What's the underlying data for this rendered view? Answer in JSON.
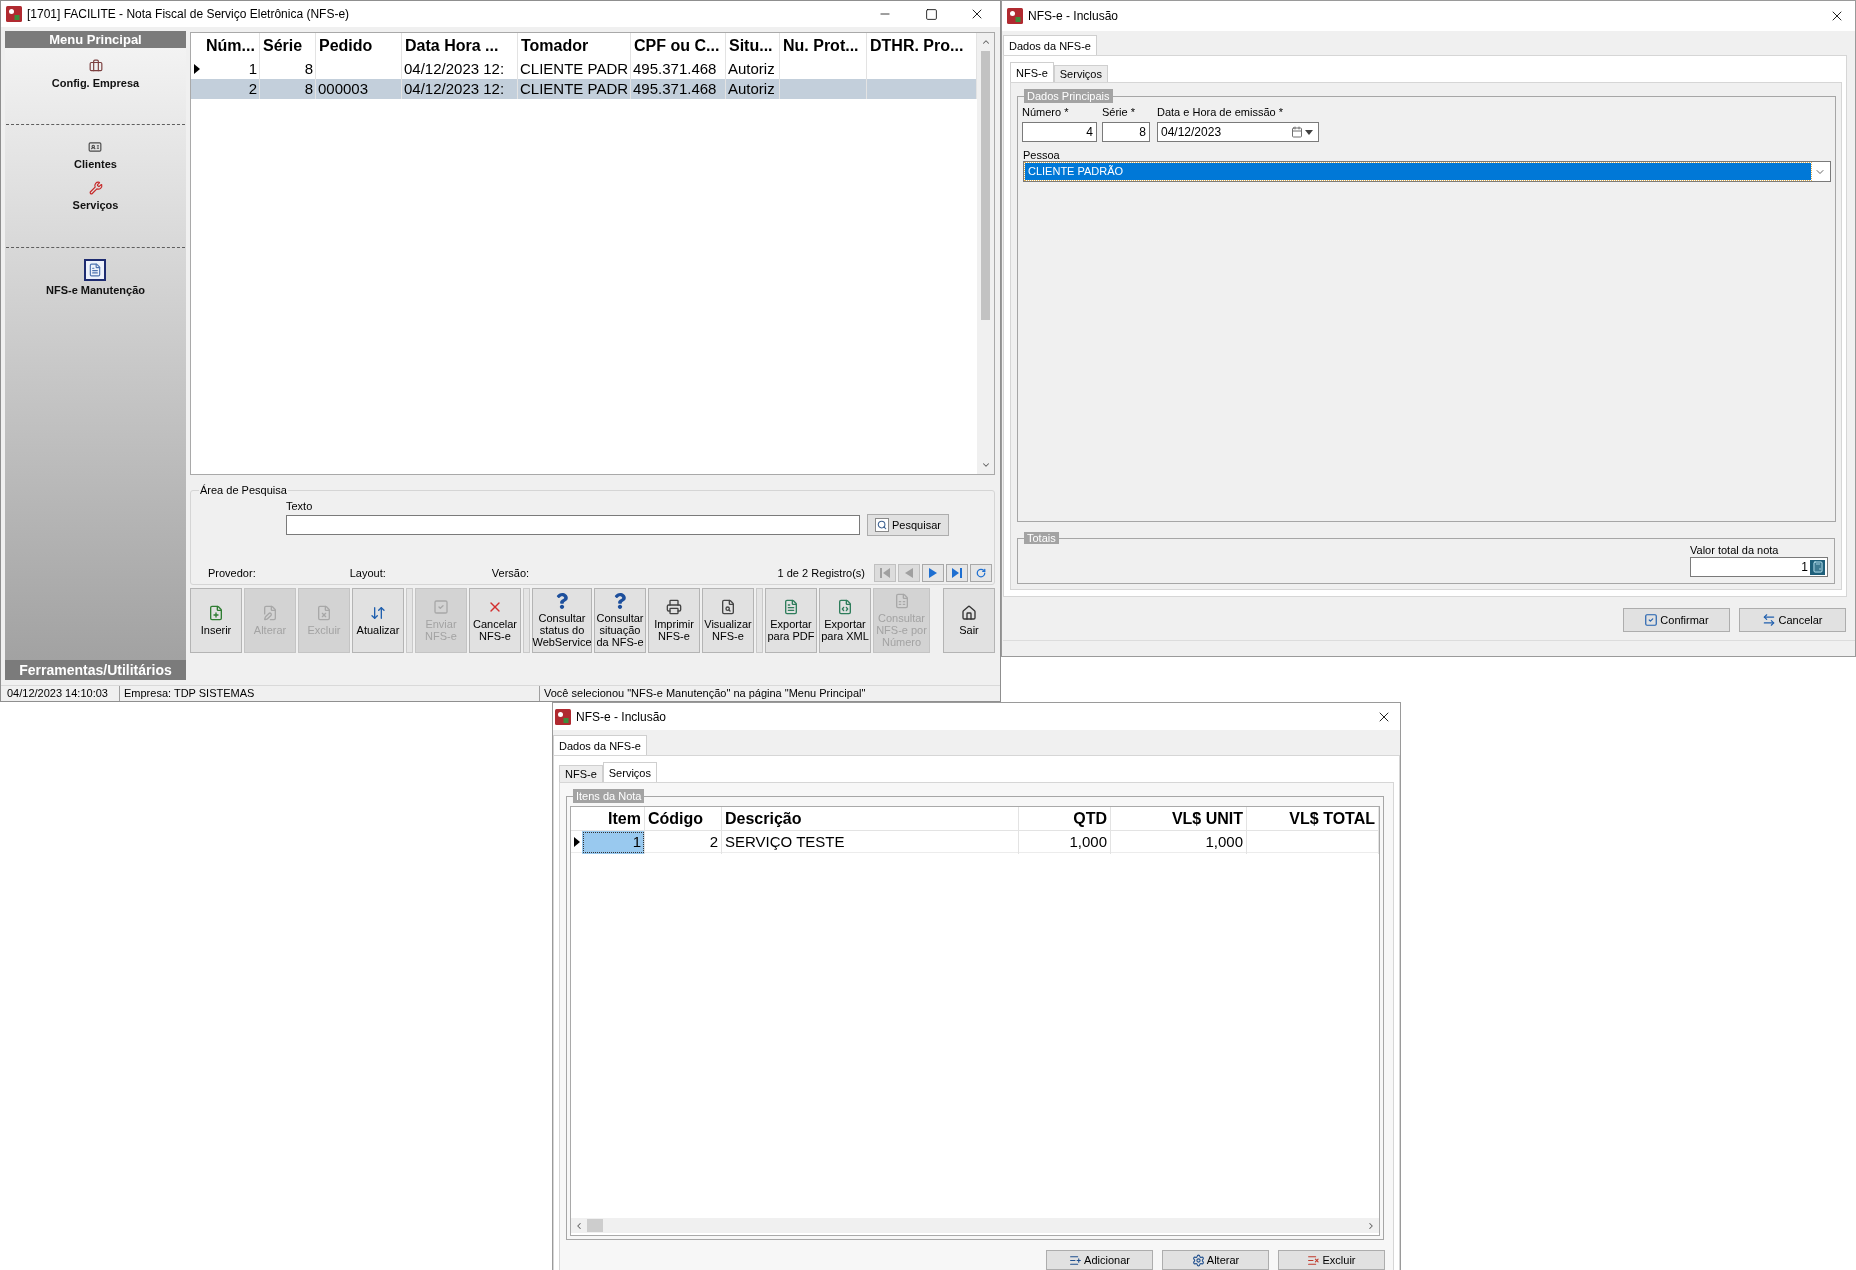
{
  "main_window": {
    "title": "[1701] FACILITE - Nota Fiscal de Serviço Eletrônica (NFS-e)",
    "sidebar": {
      "header": "Menu Principal",
      "groups": [
        {
          "items": [
            {
              "label": "Config. Empresa",
              "selected": false
            }
          ]
        },
        {
          "items": [
            {
              "label": "Clientes",
              "selected": false
            },
            {
              "label": "Serviços",
              "selected": false
            }
          ]
        },
        {
          "items": [
            {
              "label": "NFS-e Manutenção",
              "selected": true
            }
          ]
        }
      ],
      "footer": "Ferramentas/Utilitários"
    },
    "grid": {
      "columns": [
        {
          "label": "Núm..."
        },
        {
          "label": "Série"
        },
        {
          "label": "Pedido"
        },
        {
          "label": "Data Hora ..."
        },
        {
          "label": "Tomador"
        },
        {
          "label": "CPF ou C..."
        },
        {
          "label": "Situ..."
        },
        {
          "label": "Nu. Prot..."
        },
        {
          "label": "DTHR. Pro..."
        }
      ],
      "rows": [
        {
          "current": true,
          "selected": false,
          "cells": {
            "column_1": "1",
            "column_2": "8",
            "column_4": "04/12/2023 12:",
            "column_5": "CLIENTE PADR",
            "column_6": "495.371.468",
            "column_7": "Autoriz"
          }
        },
        {
          "current": false,
          "selected": true,
          "cells": {
            "column_1": "2",
            "column_2": "8",
            "column_3": "000003",
            "column_4": "04/12/2023 12:",
            "column_5": "CLIENTE PADR",
            "column_6": "495.371.468",
            "column_7": "Autoriz"
          }
        }
      ]
    },
    "search": {
      "title": "Área de Pesquisa",
      "field_label": "Texto",
      "button": "Pesquisar"
    },
    "info": {
      "provider_label": "Provedor:",
      "layout_label": "Layout:",
      "version_label": "Versão:",
      "record_count": "1 de 2 Registro(s)"
    },
    "navigation": [
      {
        "disabled": true
      },
      {
        "disabled": true
      },
      {
        "disabled": false
      },
      {
        "disabled": false
      },
      {
        "disabled": false
      }
    ],
    "toolbar": [
      {
        "kind": "button",
        "label": "Inserir",
        "disabled": false
      },
      {
        "kind": "button",
        "label": "Alterar",
        "disabled": true
      },
      {
        "kind": "button",
        "label": "Excluir",
        "disabled": true
      },
      {
        "kind": "button",
        "label": "Atualizar",
        "disabled": false
      },
      {
        "kind": "separator"
      },
      {
        "kind": "button",
        "label": "Enviar NFS-e",
        "disabled": true
      },
      {
        "kind": "button",
        "label": "Cancelar NFS-e",
        "disabled": false
      },
      {
        "kind": "separator"
      },
      {
        "kind": "button",
        "label": "Consultar status do WebService",
        "disabled": false
      },
      {
        "kind": "button",
        "label": "Consultar situação da NFS-e",
        "disabled": false
      },
      {
        "kind": "button",
        "label": "Imprimir NFS-e",
        "disabled": false
      },
      {
        "kind": "button",
        "label": "Visualizar NFS-e",
        "disabled": false
      },
      {
        "kind": "separator"
      },
      {
        "kind": "button",
        "label": "Exportar para PDF",
        "disabled": false
      },
      {
        "kind": "button",
        "label": "Exportar para XML",
        "disabled": false
      },
      {
        "kind": "button",
        "label": "Consultar NFS-e por Número",
        "disabled": true
      },
      {
        "kind": "button",
        "label": "Sair",
        "disabled": false
      }
    ],
    "status_bar": {
      "datetime": "04/12/2023 14:10:03",
      "company": "Empresa: TDP SISTEMAS",
      "message": "Você selecionou \"NFS-e Manutenção\" na página \"Menu Principal\""
    }
  },
  "inclusion_dialog": {
    "title": "NFS-e - Inclusão",
    "tabs": [
      {
        "label": "Dados da NFS-e",
        "selected": true
      }
    ],
    "inner_tabs": [
      {
        "label": "NFS-e",
        "selected": true
      },
      {
        "label": "Serviços",
        "selected": false
      }
    ],
    "main_group": {
      "title": "Dados Principais",
      "numero": {
        "label": "Número *",
        "value": "4"
      },
      "serie": {
        "label": "Série *",
        "value": "8"
      },
      "emissao": {
        "label": "Data e Hora de emissão *",
        "value": "04/12/2023"
      },
      "pessoa": {
        "label": "Pessoa",
        "value": "CLIENTE PADRÃO",
        "highlighted": true
      }
    },
    "totals": {
      "title": "Totais",
      "label": "Valor total da nota",
      "value": "1"
    },
    "buttons": [
      {
        "label": "Confirmar"
      },
      {
        "label": "Cancelar"
      }
    ]
  },
  "services_dialog": {
    "title": "NFS-e - Inclusão",
    "tabs": [
      {
        "label": "Dados da NFS-e",
        "selected": true
      }
    ],
    "inner_tabs": [
      {
        "label": "NFS-e",
        "selected": false
      },
      {
        "label": "Serviços",
        "selected": true
      }
    ],
    "group": {
      "title": "Itens da Nota",
      "columns": [
        {
          "label": "Item"
        },
        {
          "label": "Código"
        },
        {
          "label": "Descrição"
        },
        {
          "label": "QTD"
        },
        {
          "label": "VL$ UNIT"
        },
        {
          "label": "VL$ TOTAL"
        }
      ],
      "rows": [
        {
          "current": true,
          "selected": true,
          "cells": {
            "column_1": "1",
            "column_2": "2",
            "column_3": "SERVIÇO TESTE",
            "column_4": "1,000",
            "column_5": "1,000"
          }
        }
      ]
    },
    "buttons": [
      {
        "label": "Adicionar"
      },
      {
        "label": "Alterar"
      },
      {
        "label": "Excluir"
      }
    ]
  }
}
